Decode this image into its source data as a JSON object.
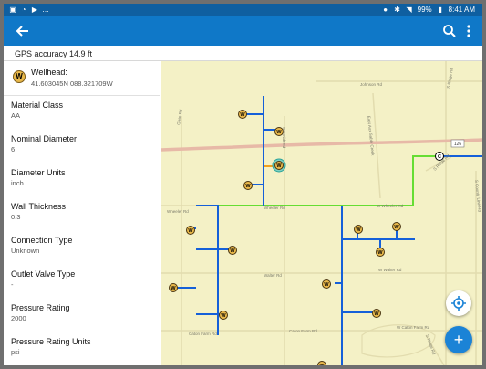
{
  "status_bar": {
    "left_icons": [
      "image-icon",
      "cast-icon",
      "play-store-icon"
    ],
    "overflow": "…",
    "battery": "99%",
    "time": "8:41 AM"
  },
  "app_bar": {
    "back_icon": "arrow-left-icon",
    "search_icon": "search-icon",
    "more_icon": "more-vert-icon"
  },
  "gps": {
    "text": "GPS accuracy 14.9 ft"
  },
  "feature": {
    "badge": "W",
    "title": "Wellhead:",
    "coords": "41.603045N 088.321709W"
  },
  "attributes": [
    {
      "label": "Material Class",
      "value": "AA"
    },
    {
      "label": "Nominal Diameter",
      "value": "6"
    },
    {
      "label": "Diameter Units",
      "value": "inch"
    },
    {
      "label": "Wall Thickness",
      "value": "0.3"
    },
    {
      "label": "Connection Type",
      "value": "Unknown"
    },
    {
      "label": "Outlet Valve Type",
      "value": "-"
    },
    {
      "label": "Pressure Rating",
      "value": "2000"
    },
    {
      "label": "Pressure Rating Units",
      "value": "psi"
    }
  ],
  "map": {
    "roads": {
      "wheeler": "Wheeler Rd",
      "wheeler2": "Wheeler Rd",
      "wheeler3": "W Wheeler Rd",
      "walter": "Walter Rd",
      "walter2": "W Walter Rd",
      "caton": "Caton Farm Rd",
      "caton2": "Caton Farm Rd",
      "caton3": "W Caton Farm Rd",
      "johnson": "Johnson Rd",
      "ridge": "S Ridge Rd",
      "ridge2": "S Ridge Rd",
      "ridge3": "S Ridge Rd",
      "eastaux": "East Aux Sable Creek",
      "county": "S County Line Rd",
      "route": "126",
      "gwin": "Gwin Rd",
      "schmidt": "Schmidt Rd"
    },
    "marker_label": "W",
    "crossing_label": "C"
  },
  "fab": {
    "locate_icon": "locate-icon",
    "add_label": "+"
  }
}
